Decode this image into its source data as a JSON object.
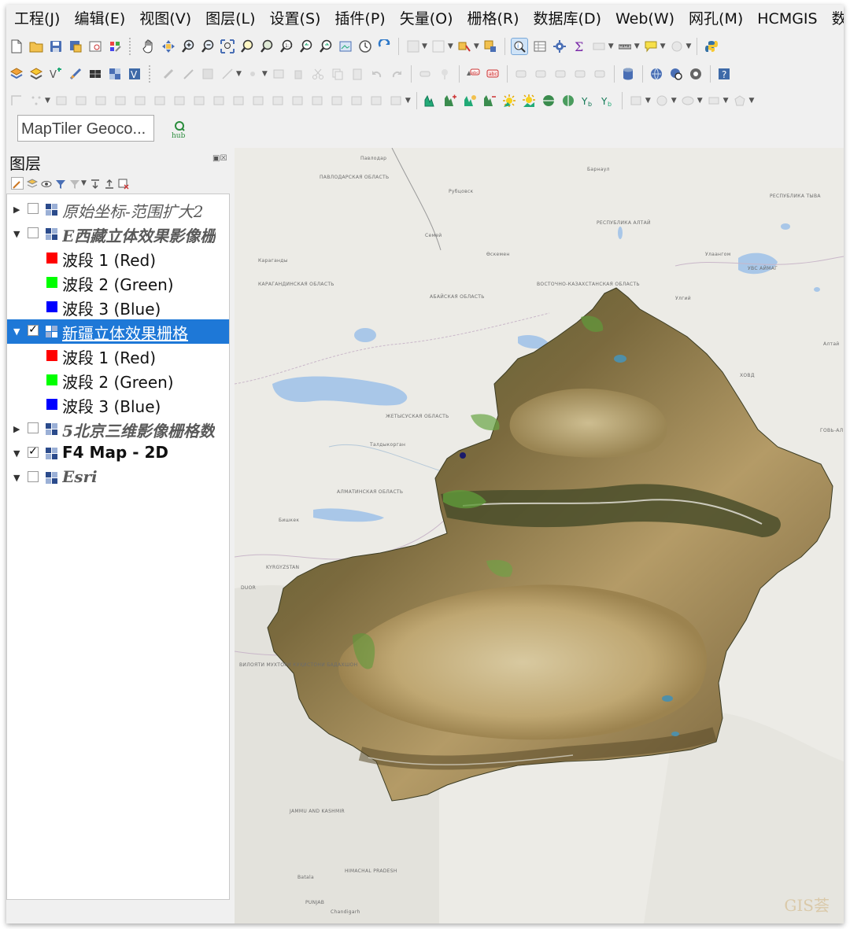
{
  "menubar": {
    "items": [
      "工程(J)",
      "编辑(E)",
      "视图(V)",
      "图层(L)",
      "设置(S)",
      "插件(P)",
      "矢量(O)",
      "栅格(R)",
      "数据库(D)",
      "Web(W)",
      "网孔(M)",
      "HCMGIS",
      "数据"
    ]
  },
  "locator": {
    "placeholder": "MapTiler Geoco...",
    "hub_label": "hub"
  },
  "layers_panel": {
    "title": "图层",
    "layers": [
      {
        "name": "原始坐标-范围扩大2",
        "checked": false,
        "expanded": false,
        "style": "italic"
      },
      {
        "name": "E西藏立体效果影像栅",
        "checked": false,
        "expanded": true,
        "style": "italic",
        "bands": [
          "波段 1 (Red)",
          "波段 2 (Green)",
          "波段 3 (Blue)"
        ]
      },
      {
        "name": "新疆立体效果栅格",
        "checked": true,
        "expanded": true,
        "style": "selected",
        "bands": [
          "波段 1 (Red)",
          "波段 2 (Green)",
          "波段 3 (Blue)"
        ]
      },
      {
        "name": "5北京三维影像栅格数",
        "checked": false,
        "expanded": false,
        "style": "italic"
      },
      {
        "name": "F4 Map - 2D",
        "checked": true,
        "expanded": true,
        "style": "bold"
      },
      {
        "name": "Esri",
        "checked": false,
        "expanded": true,
        "style": "italic"
      }
    ],
    "band_colors": [
      "#ff0000",
      "#00ff00",
      "#0000ff"
    ],
    "selection_color": "#1e78d7"
  },
  "map": {
    "labels": {
      "pavlodar": "ПАВЛОДАРСКАЯ ОБЛАСТЬ",
      "karaganda": "КАРАГАНДИНСКАЯ ОБЛАСТЬ",
      "east_kz": "ВОСТОЧНО-КАЗАХСТАНСКАЯ ОБЛАСТЬ",
      "abai": "АБАЙСКАЯ ОБЛАСТЬ",
      "zhetisu": "ЖЕТЫСУСКАЯ ОБЛАСТЬ",
      "almaty": "АЛМАТИНСКАЯ ОБЛАСТЬ",
      "kyrgyzstan": "KYRGYZSTAN",
      "bishkek": "Бишкек",
      "altai": "РЕСПУБЛИКА АЛТАЙ",
      "tuva": "РЕСПУБЛИКА ТЫВА",
      "uvs": "УВС АЙМАГ",
      "khovd": "ХОВД",
      "gobi_altai": "ГОВЬ-АЛ",
      "altai2": "Алтай",
      "rubtsovsk": "Рубцовск",
      "semey": "Семей",
      "karagandy_city": "Караганды",
      "oskemen": "Өскемен",
      "taldykorgan": "Талдыкорган",
      "ulaangom": "Улаангом",
      "ulgii": "Улгий",
      "jammu": "JAMMU AND KASHMIR",
      "himachal": "HIMACHAL PRADESH",
      "punjab": "PUNJAB",
      "tajik": "ВИЛОЯТИ МУХТОРИ КУҲИСТОНИ БАДАХШОН",
      "batala": "Batala",
      "chandigarh": "Chandigarh",
      "duor": "DUOR",
      "pavlodar_city": "Павлодар",
      "barnaul": "Барнаул"
    },
    "watermark": "GIS荟"
  }
}
